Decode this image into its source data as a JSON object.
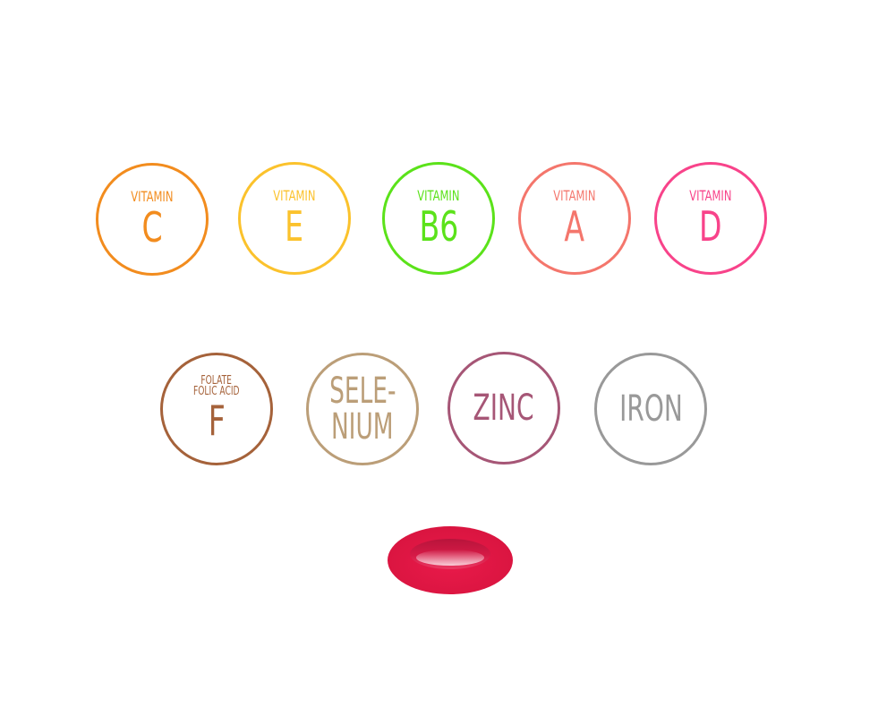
{
  "badges": [
    {
      "id": "c",
      "top_text": "VITAMIN",
      "main_text": "C",
      "color": "#f28c1e"
    },
    {
      "id": "e",
      "top_text": "VITAMIN",
      "main_text": "E",
      "color": "#fbc22c"
    },
    {
      "id": "b6",
      "top_text": "VITAMIN",
      "main_text": "B6",
      "color": "#5be21a"
    },
    {
      "id": "a",
      "top_text": "VITAMIN",
      "main_text": "A",
      "color": "#f4766c"
    },
    {
      "id": "d",
      "top_text": "VITAMIN",
      "main_text": "D",
      "color": "#f8438a"
    },
    {
      "id": "f",
      "top_text_line1": "FOLATE",
      "top_text_line2": "FOLIC ACID",
      "main_text": "F",
      "color": "#a5623a"
    },
    {
      "id": "se",
      "line1": "SELE-",
      "line2": "NIUM",
      "color": "#bb9e78"
    },
    {
      "id": "zn",
      "main_text": "ZINC",
      "color": "#a65676"
    },
    {
      "id": "fe",
      "main_text": "IRON",
      "color": "#999999"
    }
  ],
  "pill": {
    "icon": "pill-icon",
    "outer_color": "#e91a4a",
    "inner_color": "#c3163f",
    "highlight_color": "#f5b6c4"
  }
}
